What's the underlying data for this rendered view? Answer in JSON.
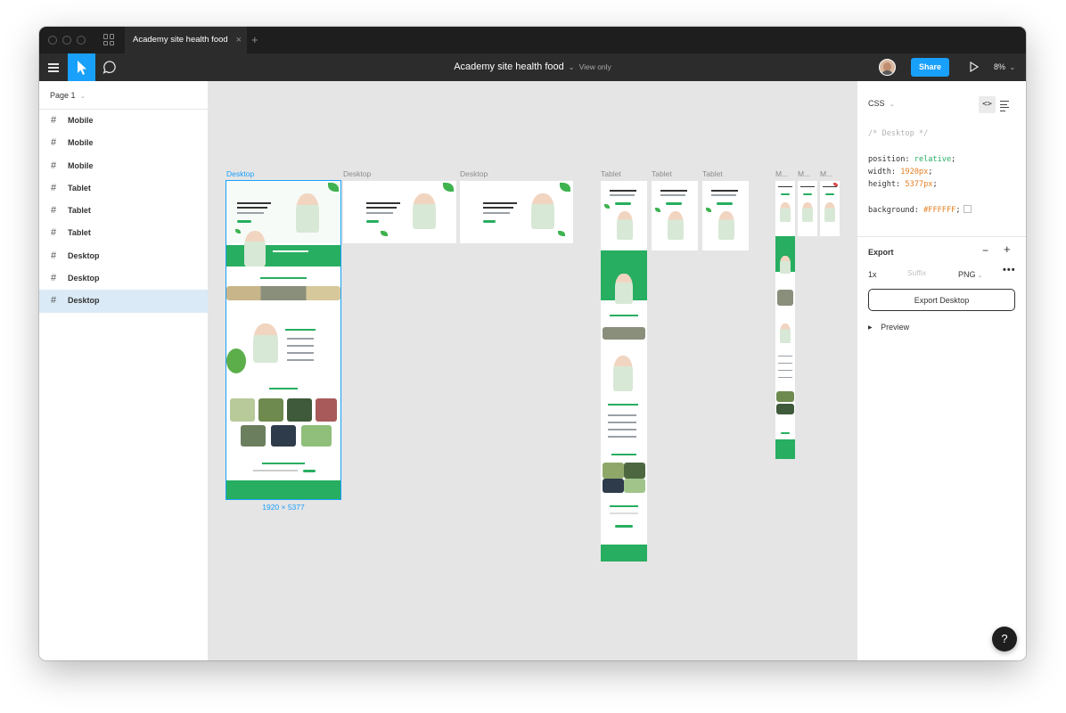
{
  "tabbar": {
    "file_tab_label": "Academy site health food",
    "close_glyph": "×",
    "add_glyph": "+"
  },
  "toolbar": {
    "file_title": "Academy site health food",
    "file_title_chevron": "⌄",
    "view_mode": "View only",
    "share_label": "Share",
    "zoom_level": "8%",
    "zoom_chevron": "⌄"
  },
  "layers": {
    "page_name": "Page 1",
    "page_chevron": "⌄",
    "frame_glyph": "#",
    "items": [
      {
        "label": "Mobile"
      },
      {
        "label": "Mobile"
      },
      {
        "label": "Mobile"
      },
      {
        "label": "Tablet"
      },
      {
        "label": "Tablet"
      },
      {
        "label": "Tablet"
      },
      {
        "label": "Desktop"
      },
      {
        "label": "Desktop"
      },
      {
        "label": "Desktop"
      }
    ],
    "selected_index": 8
  },
  "canvas": {
    "frame_labels": {
      "desktop_1": "Desktop",
      "desktop_2": "Desktop",
      "desktop_3": "Desktop",
      "tablet_1": "Tablet",
      "tablet_2": "Tablet",
      "tablet_3": "Tablet",
      "mobile_1": "M...",
      "mobile_2": "M...",
      "mobile_3": "M..."
    },
    "selected_dimensions": "1920 × 5377"
  },
  "inspector": {
    "code_language": "CSS",
    "code_language_chevron": "⌄",
    "code_toggle_glyph": "<>",
    "css": {
      "comment": "/* Desktop */",
      "position_prop": "position:",
      "position_val": "relative",
      "width_prop": "width:",
      "width_val": "1920px",
      "height_prop": "height:",
      "height_val": "5377px",
      "background_prop": "background:",
      "background_val": "#FFFFFF",
      "semicolon": ";"
    },
    "export": {
      "title": "Export",
      "remove_glyph": "−",
      "add_glyph": "+",
      "scale": "1x",
      "suffix_placeholder": "Suffix",
      "format": "PNG",
      "format_chevron": "⌄",
      "more_glyph": "•••",
      "button_label": "Export Desktop",
      "preview_glyph": "▶",
      "preview_label": "Preview"
    }
  },
  "help": {
    "label": "?"
  },
  "colors": {
    "accent": "#18a0fb",
    "brand_green": "#27ae60",
    "toolbar_bg": "#2c2c2c",
    "titlebar_bg": "#1e1e1e",
    "canvas_bg": "#e5e5e5"
  },
  "icons": {
    "menu": "hamburger-icon",
    "move": "move-pointer-icon",
    "comment": "comment-icon",
    "play": "play-icon",
    "grid": "grid-icon",
    "frame": "frame-hash-icon",
    "list": "list-icon"
  }
}
